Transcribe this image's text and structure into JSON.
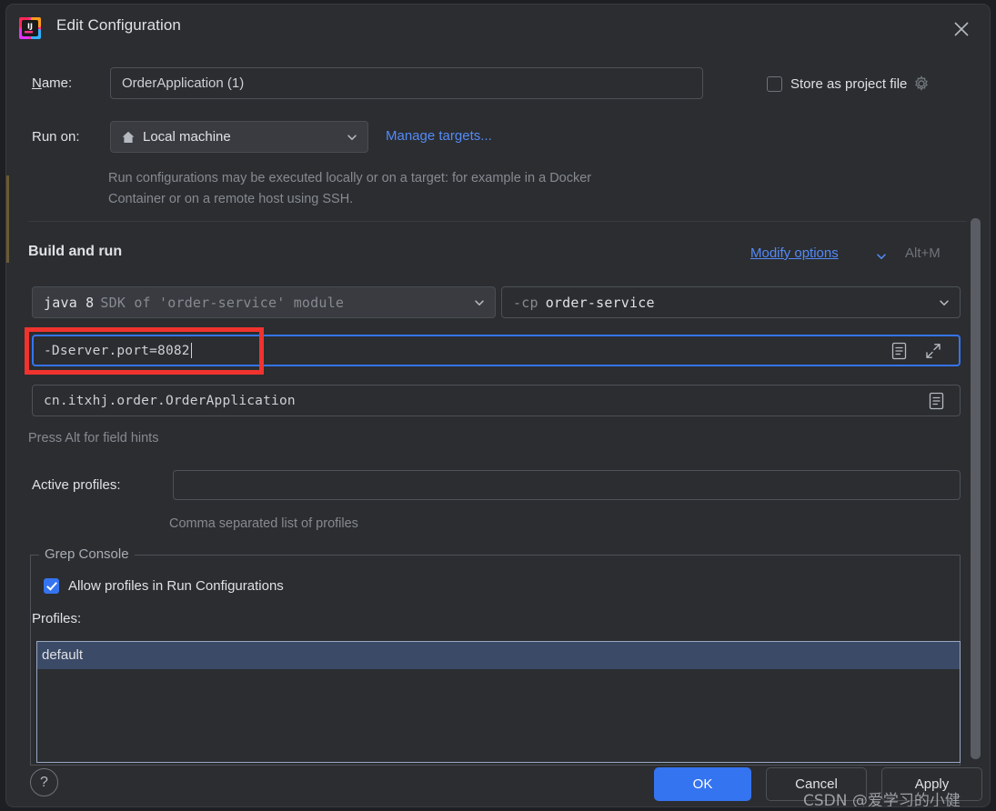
{
  "window": {
    "title": "Edit Configuration",
    "app_icon": "intellij-idea-icon",
    "close_icon": "close-icon"
  },
  "form": {
    "name_label": "Name:",
    "name_label_mnemonic": "N",
    "name_label_rest": "ame:",
    "name_value": "OrderApplication (1)",
    "run_on_label": "Run on:",
    "run_on_value": "Local machine",
    "run_on_icon": "home-icon",
    "manage_targets_link": "Manage targets...",
    "description": "Run configurations may be executed locally or on a target: for example in a Docker Container or on a remote host using SSH.",
    "store_as_project_file_label": "Store as project file",
    "store_as_project_file_checked": false,
    "store_gear_icon": "gear-icon"
  },
  "build_and_run": {
    "section_title": "Build and run",
    "modify_options_link": "Modify options",
    "modify_options_chevron": "chevron-down-icon",
    "modify_options_shortcut": "Alt+M",
    "sdk_value_bright": "java 8",
    "sdk_value_dim": "SDK of 'order-service' module",
    "classpath_dim": "-cp",
    "classpath_bright": "order-service",
    "vm_options_value": "-Dserver.port=8082",
    "vm_options_doc_icon": "document-icon",
    "vm_options_expand_icon": "expand-icon",
    "main_class_value": "cn.itxhj.order.OrderApplication",
    "main_class_doc_icon": "document-icon",
    "field_hint": "Press Alt for field hints"
  },
  "active_profiles": {
    "label": "Active profiles:",
    "value": "",
    "hint": "Comma separated list of profiles"
  },
  "grep_console": {
    "legend": "Grep Console",
    "allow_profiles_label": "Allow profiles in Run Configurations",
    "allow_profiles_checked": true,
    "profiles_label": "Profiles:",
    "profiles_items": [
      "default"
    ],
    "selected_profile": "default"
  },
  "footer": {
    "help_label": "?",
    "ok_label": "OK",
    "cancel_label": "Cancel",
    "apply_label": "Apply"
  },
  "watermark": "CSDN @爱学习的小健",
  "colors": {
    "accent_blue": "#3574f0",
    "link_blue": "#548af7",
    "annotation_red": "#f0332e",
    "selection_blue": "#3b4a66",
    "dialog_bg": "#2b2d30"
  }
}
